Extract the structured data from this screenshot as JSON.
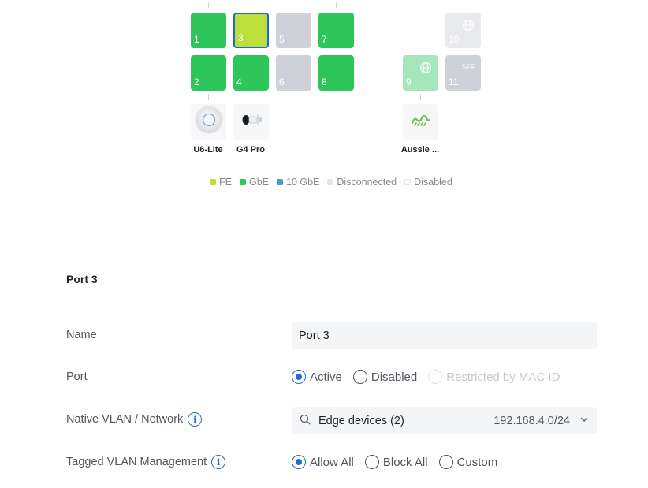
{
  "ports": {
    "p1": "1",
    "p2": "2",
    "p3": "3",
    "p4": "4",
    "p5": "5",
    "p6": "6",
    "p7": "7",
    "p8": "8",
    "p9": "9",
    "p10": "10",
    "p11": "11",
    "sfp_label": "SFP"
  },
  "devices": {
    "u6": "U6-Lite",
    "g4": "G4 Pro",
    "aussie": "Aussie ..."
  },
  "legend": {
    "fe": "FE",
    "gbe": "GbE",
    "tengbe": "10 GbE",
    "disconnected": "Disconnected",
    "disabled": "Disabled"
  },
  "colors": {
    "fe": "#bddf3a",
    "gbe": "#2ec55a",
    "tengbe": "#3aa3c9",
    "disconnected": "#e6e7ea",
    "disabled": "#ffffff",
    "accent": "#1f69d4"
  },
  "section": {
    "title": "Port 3"
  },
  "form": {
    "name_label": "Name",
    "name_value": "Port 3",
    "port_label": "Port",
    "port_options": [
      "Active",
      "Disabled",
      "Restricted by MAC ID"
    ],
    "port_selected": "Active",
    "vlan_label": "Native VLAN / Network",
    "vlan_value": "Edge devices (2)",
    "vlan_subnet": "192.168.4.0/24",
    "tagged_label": "Tagged VLAN Management",
    "tagged_options": [
      "Allow All",
      "Block All",
      "Custom"
    ],
    "tagged_selected": "Allow All"
  },
  "icons": [
    "info-icon",
    "search-icon",
    "chevron-down-icon",
    "globe-icon",
    "access-point-icon",
    "camera-icon",
    "isp-logo-icon"
  ]
}
